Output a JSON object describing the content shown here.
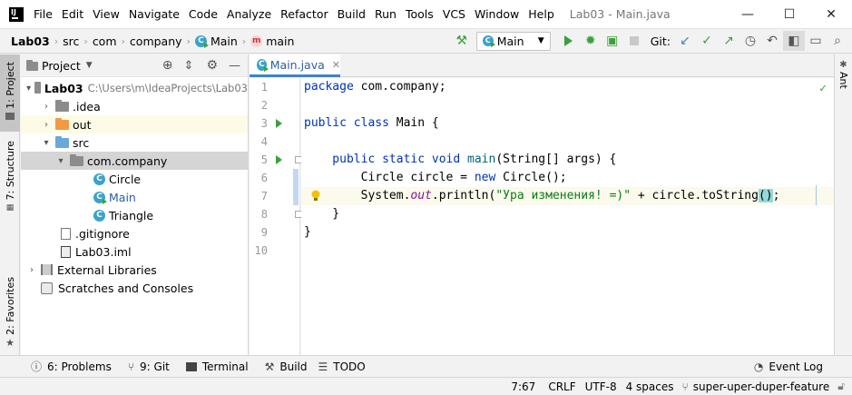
{
  "menu": [
    "File",
    "Edit",
    "View",
    "Navigate",
    "Code",
    "Analyze",
    "Refactor",
    "Build",
    "Run",
    "Tools",
    "VCS",
    "Window",
    "Help"
  ],
  "window_title": "Lab03 - Main.java",
  "breadcrumbs": {
    "project": "Lab03",
    "c1": "src",
    "c2": "com",
    "c3": "company",
    "cls": "Main",
    "method": "main"
  },
  "toolbar": {
    "run_config": "Main",
    "git": "Git:"
  },
  "left_tabs": {
    "project": "1: Project",
    "structure": "7: Structure",
    "favorites": "2: Favorites"
  },
  "project_panel": {
    "title": "Project",
    "tree": [
      {
        "label": "Lab03",
        "extra": "C:\\Users\\m\\IdeaProjects\\Lab03"
      },
      {
        "label": ".idea"
      },
      {
        "label": "out"
      },
      {
        "label": "src"
      },
      {
        "label": "com.company"
      },
      {
        "label": "Circle"
      },
      {
        "label": "Main"
      },
      {
        "label": "Triangle"
      },
      {
        "label": ".gitignore"
      },
      {
        "label": "Lab03.iml"
      },
      {
        "label": "External Libraries"
      },
      {
        "label": "Scratches and Consoles"
      }
    ]
  },
  "editor": {
    "tab": "Main.java",
    "line_numbers": [
      "1",
      "2",
      "3",
      "4",
      "5",
      "6",
      "7",
      "8",
      "9",
      "10"
    ],
    "code": {
      "l1a": "package",
      "l1b": " com.company;",
      "l3a": "public class",
      "l3b": " Main {",
      "l5a": "    public static void",
      "l5b": " main",
      "l5c": "(String[] args) {",
      "l6a": "        Circle circle = ",
      "l6b": "new",
      "l6c": " Circle();",
      "l7a": "        System.",
      "l7b": "out",
      "l7c": ".println(",
      "l7d": "\"Ура изменения! =)\"",
      "l7e": " + circle.toString",
      "l7f": "()",
      "l7g": ";",
      "l8": "    }",
      "l9": "}"
    }
  },
  "right_tabs": {
    "ant": "Ant"
  },
  "bottom_tabs": [
    "6: Problems",
    "9: Git",
    "Terminal",
    "Build",
    "TODO"
  ],
  "event_log": "Event Log",
  "status": {
    "pos": "7:67",
    "le": "CRLF",
    "enc": "UTF-8",
    "indent": "4 spaces",
    "branch": "super-uper-duper-feature"
  },
  "colors": {
    "accent": "#4083c9",
    "run": "#3c9f3c",
    "keyword": "#0033b3",
    "string": "#067d17",
    "field": "#871094"
  }
}
